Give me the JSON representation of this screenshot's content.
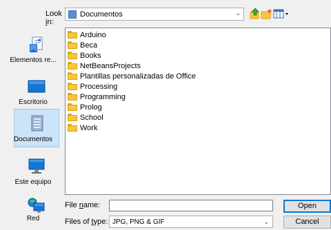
{
  "lookin": {
    "label_pre": "Look ",
    "label_u": "i",
    "label_post": "n:",
    "value": "Documentos"
  },
  "places": [
    {
      "label": "Elementos re...",
      "icon": "recent-items-icon"
    },
    {
      "label": "Escritorio",
      "icon": "desktop-icon"
    },
    {
      "label": "Documentos",
      "icon": "documents-icon",
      "selected": true
    },
    {
      "label": "Este equipo",
      "icon": "computer-icon"
    },
    {
      "label": "Red",
      "icon": "network-icon"
    }
  ],
  "files": [
    "Arduino",
    "Beca",
    "Books",
    "NetBeansProjects",
    "Plantillas personalizadas de Office",
    "Processing",
    "Programming",
    "Prolog",
    "School",
    "Work"
  ],
  "filename": {
    "label_pre": "File ",
    "label_u": "n",
    "label_post": "ame:",
    "value": ""
  },
  "filetype": {
    "label_pre": "Files of ",
    "label_u": "t",
    "label_post": "ype:",
    "value": "JPG, PNG & GIF"
  },
  "buttons": {
    "open": "Open",
    "cancel": "Cancel"
  },
  "colors": {
    "selection": "#cce4f7",
    "folder": "#f8c63c",
    "accent": "#0078d7"
  }
}
